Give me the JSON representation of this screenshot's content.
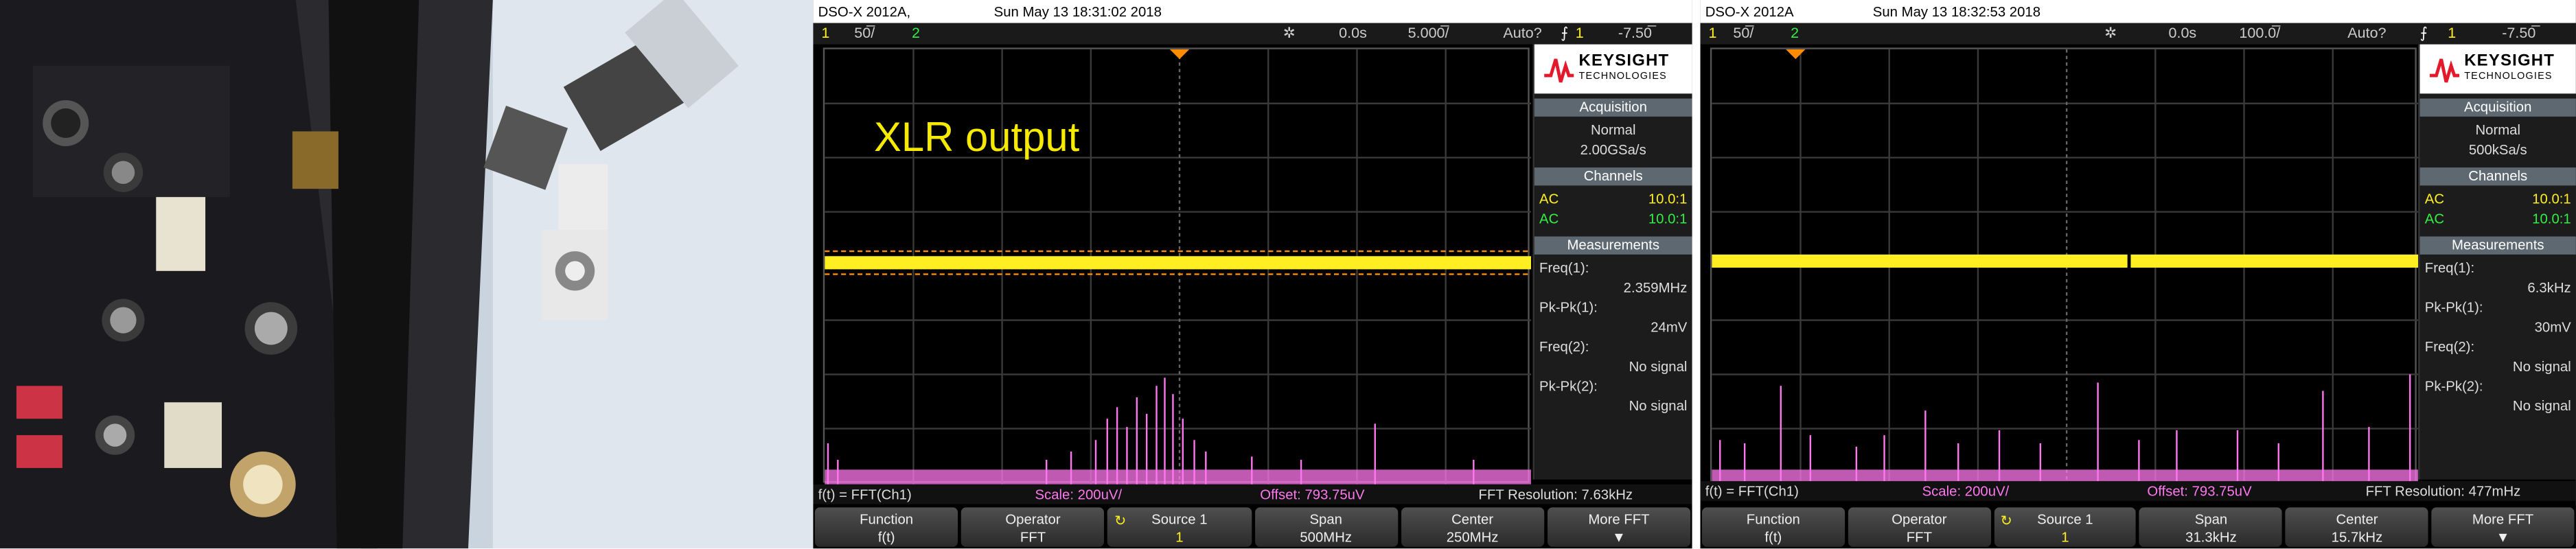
{
  "left_scope": {
    "model": "DSO-X 2012A,",
    "datetime": "Sun May 13 18:31:02 2018",
    "channel": "1",
    "vdiv": "50̅/",
    "trigger_ch": "2",
    "delay": "0.0s",
    "timebase": "5.000̅/",
    "trig_mode": "Auto?",
    "trig_src": "1",
    "trig_level": "-7.50̅",
    "overlay_title": "XLR output",
    "brand": "KEYSIGHT",
    "brand_sub": "TECHNOLOGIES",
    "acq_header": "Acquisition",
    "acq_mode": "Normal",
    "acq_rate": "2.00GSa/s",
    "ch_header": "Channels",
    "ch1_coupling": "AC",
    "ch1_probe": "10.0:1",
    "ch2_coupling": "AC",
    "ch2_probe": "10.0:1",
    "meas_header": "Measurements",
    "freq1_label": "Freq(1):",
    "freq1_value": "2.359MHz",
    "pkpk1_label": "Pk-Pk(1):",
    "pkpk1_value": "24mV",
    "freq2_label": "Freq(2):",
    "freq2_value": "No signal",
    "pkpk2_label": "Pk-Pk(2):",
    "pkpk2_value": "No signal",
    "fft_func": "f(t) = FFT(Ch1)",
    "fft_scale": "Scale: 200uV/",
    "fft_offset": "Offset: 793.75uV",
    "fft_res": "FFT Resolution: 7.63kHz",
    "keys": [
      {
        "t": "Function",
        "v": "f(t)"
      },
      {
        "t": "Operator",
        "v": "FFT"
      },
      {
        "t": "Source 1",
        "v": "1"
      },
      {
        "t": "Span",
        "v": "500MHz"
      },
      {
        "t": "Center",
        "v": "250MHz"
      },
      {
        "t": "More FFT",
        "v": "▼"
      }
    ]
  },
  "right_scope": {
    "model": "DSO-X 2012A",
    "datetime": "Sun May 13 18:32:53 2018",
    "channel": "1",
    "vdiv": "50̅/",
    "trigger_ch": "2",
    "delay": "0.0s",
    "timebase": "100.0̅/",
    "trig_mode": "Auto?",
    "trig_src": "1",
    "trig_level": "-7.50̅",
    "brand": "KEYSIGHT",
    "brand_sub": "TECHNOLOGIES",
    "acq_header": "Acquisition",
    "acq_mode": "Normal",
    "acq_rate": "500kSa/s",
    "ch_header": "Channels",
    "ch1_coupling": "AC",
    "ch1_probe": "10.0:1",
    "ch2_coupling": "AC",
    "ch2_probe": "10.0:1",
    "meas_header": "Measurements",
    "freq1_label": "Freq(1):",
    "freq1_value": "6.3kHz",
    "pkpk1_label": "Pk-Pk(1):",
    "pkpk1_value": "30mV",
    "freq2_label": "Freq(2):",
    "freq2_value": "No signal",
    "pkpk2_label": "Pk-Pk(2):",
    "pkpk2_value": "No signal",
    "fft_func": "f(t) = FFT(Ch1)",
    "fft_scale": "Scale: 200uV/",
    "fft_offset": "Offset: 793.75uV",
    "fft_res": "FFT Resolution: 477mHz",
    "keys": [
      {
        "t": "Function",
        "v": "f(t)"
      },
      {
        "t": "Operator",
        "v": "FFT"
      },
      {
        "t": "Source 1",
        "v": "1"
      },
      {
        "t": "Span",
        "v": "31.3kHz"
      },
      {
        "t": "Center",
        "v": "15.7kHz"
      },
      {
        "t": "More FFT",
        "v": "▼"
      }
    ]
  },
  "colors": {
    "ch1": "#ffee22",
    "ch2": "#33ee44",
    "fft": "#ff77ee",
    "panel_header": "#5d6870"
  }
}
